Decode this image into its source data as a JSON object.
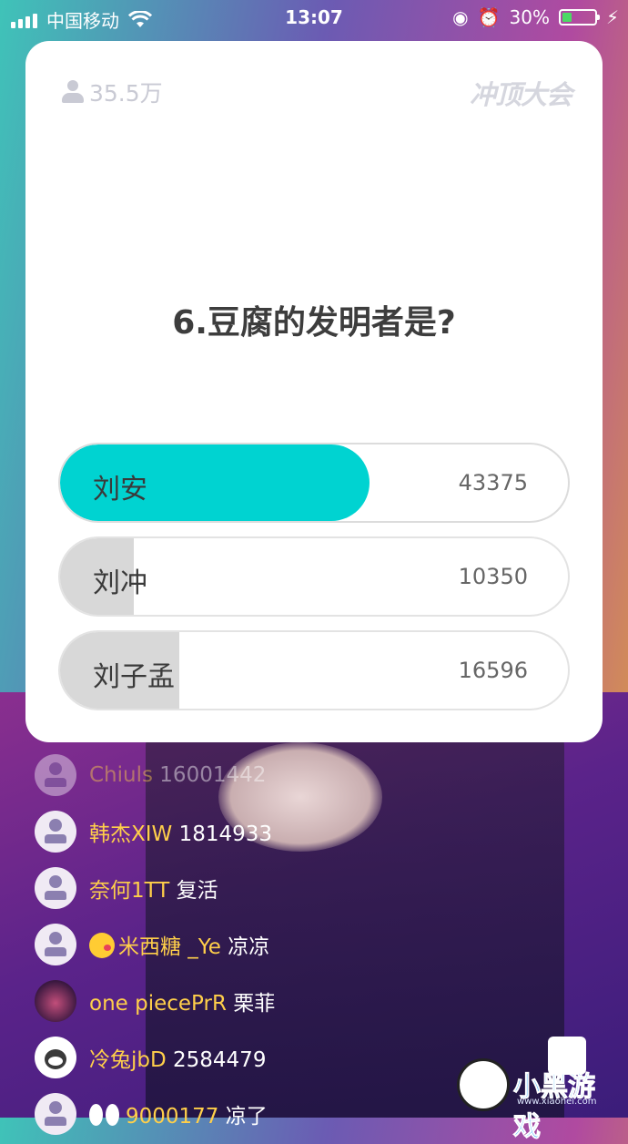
{
  "status_bar": {
    "carrier": "中国移动",
    "time": "13:07",
    "battery": "30%",
    "battery_level": 0.3
  },
  "card": {
    "viewers": "35.5万",
    "logo": "冲顶大会",
    "question": "6.豆腐的发明者是?",
    "options": [
      {
        "label": "刘安",
        "count": "43375",
        "fill": 0.61,
        "correct": true
      },
      {
        "label": "刘冲",
        "count": "10350",
        "fill": 0.145,
        "correct": false
      },
      {
        "label": "刘子孟",
        "count": "16596",
        "fill": 0.235,
        "correct": false
      }
    ]
  },
  "comments": [
    {
      "user": "Chiuls",
      "text": "16001442"
    },
    {
      "user": "韩杰XIW",
      "text": "1814933"
    },
    {
      "user": "奈何1TT",
      "text": "复活"
    },
    {
      "user": "米西糖 _Ye",
      "text": "凉凉"
    },
    {
      "user": "one piecePrR",
      "text": "栗菲"
    },
    {
      "user": "冷兔jbD",
      "text": "2584479"
    },
    {
      "user": "9000177",
      "text": "凉了"
    }
  ],
  "watermark": {
    "title": "小黑游戏",
    "url": "www.xiaohei.com"
  },
  "colors": {
    "accent": "#00d3d1",
    "username": "#ffcf4a"
  }
}
